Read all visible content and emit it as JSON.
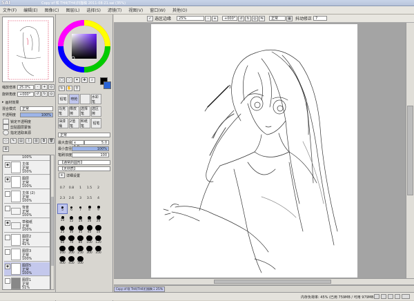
{
  "titlebar": {
    "app": "SAI",
    "title": "Copy of 咲 TH4(TH4)扫描稿 2011-08-21.sai (35%)"
  },
  "menubar": [
    "文件(F)",
    "编辑(E)",
    "图像(C)",
    "图层(L)",
    "选择(S)",
    "滤镜(T)",
    "视图(V)",
    "窗口(W)",
    "其他(O)"
  ],
  "nav": {
    "zoom_label": "缩放倍率",
    "zoom_value": "25.0%",
    "angle_label": "旋转角度",
    "angle_value": "+000°"
  },
  "layer_props": {
    "texture_label": "画材效果",
    "blend_label": "混合模式",
    "blend_value": "正常",
    "opacity_label": "不透明度",
    "opacity_value": "100%",
    "opt1": "锁定不透明度",
    "opt2": "剪贴图层蒙板",
    "opt3": "指定选取来源"
  },
  "layers": [
    {
      "name": "主体",
      "mode": "正常",
      "opacity": "100%",
      "visible": true,
      "selected": false
    },
    {
      "name": "图层",
      "mode": "正常",
      "opacity": "100%",
      "visible": true,
      "selected": false
    },
    {
      "name": "主体 (2)",
      "mode": "正常",
      "opacity": "100%",
      "visible": false,
      "selected": false
    },
    {
      "name": "背景",
      "mode": "正常",
      "opacity": "100%",
      "visible": false,
      "selected": false,
      "folder": true
    },
    {
      "name": "草稿纸",
      "mode": "正常",
      "opacity": "100%",
      "visible": true,
      "selected": false,
      "folder": true
    },
    {
      "name": "图层2",
      "mode": "正常",
      "opacity": "41%",
      "visible": false,
      "selected": false
    },
    {
      "name": "图层3",
      "mode": "正常",
      "opacity": "100%",
      "visible": false,
      "selected": false
    },
    {
      "name": "图层5",
      "mode": "正常",
      "opacity": "100%",
      "visible": true,
      "selected": true
    },
    {
      "name": "图层1",
      "mode": "正常",
      "opacity": "51%",
      "visible": false,
      "selected": false
    }
  ],
  "tools": {
    "row1": [
      "铅笔",
      "喷枪",
      "",
      "水彩笔"
    ],
    "row2": [
      "马克笔",
      "橡皮擦",
      "选择笔",
      "选区擦"
    ],
    "row3": [
      "油漆桶",
      "2值笔",
      "和纸笔",
      "铅笔"
    ],
    "blend_mode": "正常",
    "max_size_label": "最大直径",
    "max_size_mult": "x 1.0",
    "max_size_value": "5.0",
    "min_size_label": "最小直径",
    "min_size_value": "100%",
    "density_label": "笔刷浓度",
    "density_value": "100",
    "shape_label": "【通常的圆形】",
    "texture_label": "【无材质】",
    "detail_label": "详细设置",
    "sizes": [
      "0.7",
      "0.8",
      "1",
      "1.5",
      "2",
      "2.3",
      "2.6",
      "3",
      "3.5",
      "4",
      "5",
      "6",
      "7",
      "8",
      "9",
      "10",
      "12",
      "14",
      "16",
      "20",
      "25",
      "30",
      "35",
      "40",
      "50",
      "60",
      "70",
      "80",
      "100",
      "120",
      "160",
      "200",
      "250",
      "300",
      "350",
      "400",
      "450",
      "500"
    ],
    "selected_size": "5"
  },
  "canvas_toolbar": {
    "sel_edge": "选区边缘",
    "zoom": "25%",
    "angle": "+000°",
    "mode": "正常",
    "stab_label": "抖动修正",
    "stab_value": "7"
  },
  "canvas_tab": {
    "name": "Copy of 咲 TH4(TH4)扫描稿 2011-08-21.sai",
    "zoom": "25%"
  },
  "status": {
    "memory": "内存负荷率: 45% (已用 759MB / 可用 979MB)"
  }
}
